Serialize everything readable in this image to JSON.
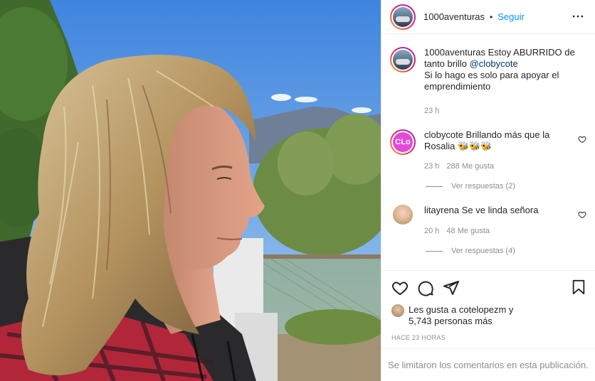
{
  "post": {
    "username": "1000aventuras",
    "follow_label": "Seguir",
    "separator": "•"
  },
  "caption": {
    "username": "1000aventuras",
    "text": "Estoy ABURRIDO de tanto brillo",
    "mention": "@clobycote",
    "text2": "Si lo hago es solo para apoyar el emprendimiento",
    "time": "23 h"
  },
  "comments": [
    {
      "username": "clobycote",
      "text": "Brillando más que la Rosalia 🐝🐝🐝",
      "avatar_text": "CLo",
      "time": "23 h",
      "likes": "288 Me gusta",
      "replies": "Ver respuestas (2)"
    },
    {
      "username": "litayrena",
      "text": "Se ve linda señora",
      "time": "20 h",
      "likes": "48 Me gusta",
      "replies": "Ver respuestas (4)"
    }
  ],
  "likes": {
    "line1": "Les gusta a cotelopezm y",
    "line2": "5,743 personas más"
  },
  "timestamp": "HACE 23 HORAS",
  "comments_limited": "Se limitaron los comentarios en esta publicación.",
  "colors": {
    "link_blue": "#0095f6",
    "mention_blue": "#00376b",
    "muted": "#8e8e8e"
  },
  "icons": [
    "more-icon",
    "heart-icon",
    "comment-icon",
    "share-icon",
    "bookmark-icon"
  ]
}
